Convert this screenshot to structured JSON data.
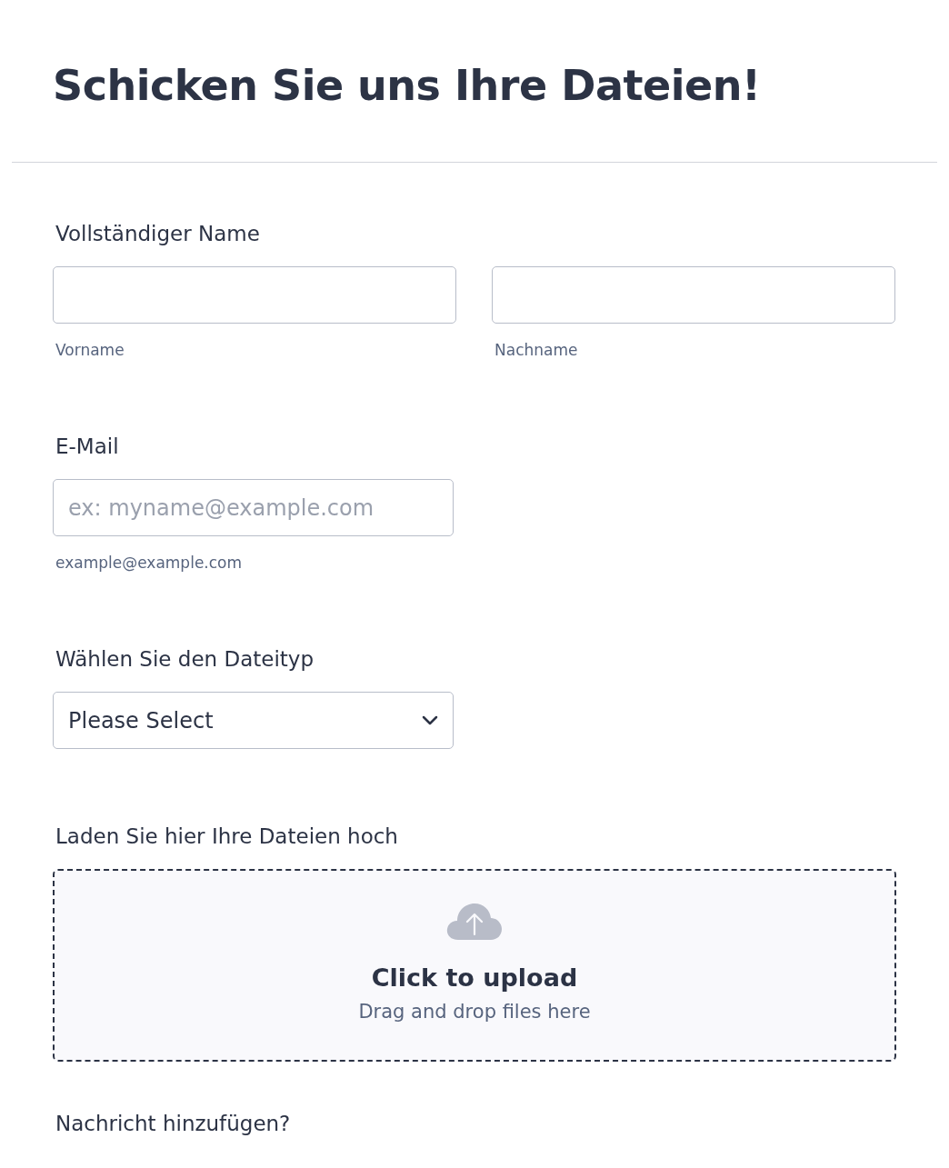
{
  "title": "Schicken Sie uns Ihre Dateien!",
  "name_field": {
    "label": "Vollständiger Name",
    "parts": [
      {
        "sublabel": "Vorname"
      },
      {
        "sublabel": "Nachname"
      }
    ]
  },
  "email_field": {
    "label": "E-Mail",
    "placeholder": "ex: myname@example.com",
    "sublabel": "example@example.com"
  },
  "file_type": {
    "label": "Wählen Sie den Dateityp",
    "value": "Please Select"
  },
  "upload": {
    "label": "Laden Sie hier Ihre Dateien hoch",
    "title": "Click to upload",
    "hint": "Drag and drop files here"
  },
  "message": {
    "label": "Nachricht hinzufügen?"
  }
}
